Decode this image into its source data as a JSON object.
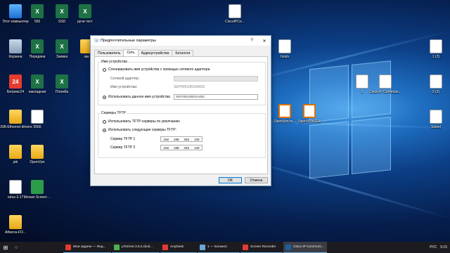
{
  "desktop": {
    "icons": [
      {
        "label": "Этот компьютер",
        "glyph": "",
        "cls": "g-pc",
        "icon": "computer-icon"
      },
      {
        "label": "555",
        "glyph": "X",
        "cls": "g-xls",
        "icon": "excel-icon"
      },
      {
        "label": "SSD",
        "glyph": "X",
        "cls": "g-xls",
        "icon": "excel-icon"
      },
      {
        "label": "ручи тест",
        "glyph": "X",
        "cls": "g-xls",
        "icon": "excel-icon"
      },
      {
        "label": "CiscoIPCo...",
        "glyph": "C",
        "cls": "g-cisco",
        "icon": "cisco-icon"
      },
      {
        "label": "Корзина",
        "glyph": "",
        "cls": "g-bin",
        "icon": "recycle-bin-icon"
      },
      {
        "label": "Передача",
        "glyph": "X",
        "cls": "g-xls",
        "icon": "excel-icon"
      },
      {
        "label": "Заявка",
        "glyph": "X",
        "cls": "g-xls",
        "icon": "excel-icon"
      },
      {
        "label": "зак",
        "glyph": "",
        "cls": "g-folder",
        "icon": "folder-icon"
      },
      {
        "label": "hosts",
        "glyph": "",
        "cls": "g-doc",
        "icon": "document-icon"
      },
      {
        "label": "1 (2)",
        "glyph": "",
        "cls": "g-doc",
        "icon": "document-icon"
      },
      {
        "label": "Битрикс24",
        "glyph": "24",
        "cls": "g-app",
        "icon": "bitrix24-icon"
      },
      {
        "label": "накладная",
        "glyph": "X",
        "cls": "g-xls",
        "icon": "excel-icon"
      },
      {
        "label": "Пломба",
        "glyph": "X",
        "cls": "g-xls",
        "icon": "excel-icon"
      },
      {
        "label": "1",
        "glyph": "",
        "cls": "g-doc",
        "icon": "document-icon"
      },
      {
        "label": "Cisco IP Communi...",
        "glyph": "C",
        "cls": "g-cisco",
        "icon": "cisco-icon"
      },
      {
        "label": "2 (2)",
        "glyph": "",
        "cls": "g-doc",
        "icon": "document-icon"
      },
      {
        "label": "USB-Ethernet drivers",
        "glyph": "",
        "cls": "g-usb",
        "icon": "folder-icon"
      },
      {
        "label": "5566",
        "glyph": "",
        "cls": "g-doc",
        "icon": "document-icon"
      },
      {
        "label": "OpenVpn-in...",
        "glyph": "V",
        "cls": "g-vpn",
        "icon": "openvpn-icon"
      },
      {
        "label": "OpenVPN GUI",
        "glyph": "V",
        "cls": "g-vpn",
        "icon": "openvpn-icon"
      },
      {
        "label": "Siebel",
        "glyph": "",
        "cls": "g-doc",
        "icon": "document-icon"
      },
      {
        "label": "job",
        "glyph": "",
        "cls": "g-folder",
        "icon": "folder-icon"
      },
      {
        "label": "OpenVpn",
        "glyph": "",
        "cls": "g-folder",
        "icon": "folder-icon"
      },
      {
        "label": "rufus-3.17",
        "glyph": "",
        "cls": "g-doc",
        "icon": "rufus-icon"
      },
      {
        "label": "Movavi Screen ...",
        "glyph": "",
        "cls": "g-green",
        "icon": "movavi-icon"
      },
      {
        "label": "Atheros-FO...",
        "glyph": "",
        "cls": "g-folder",
        "icon": "folder-icon"
      }
    ]
  },
  "dialog": {
    "title": "Предпочтительные параметры",
    "help": "?",
    "close": "✕",
    "tabs": [
      "Пользователь",
      "Сеть",
      "Аудиоустройства",
      "Каталоги"
    ],
    "device_group": {
      "legend": "Имя устройства",
      "radio_adapter": "Сгенерировать имя устройства с помощью сетевого адаптера",
      "adapter_label": "Сетевой адаптер:",
      "adapter_value": "",
      "devname_label": "Имя устройства:",
      "devname_value": "SEP4061860SA692",
      "radio_custom": "Использовать данное имя устройства",
      "custom_value": "SEP4061860SA692"
    },
    "tftp_group": {
      "legend": "Серверы TFTP",
      "radio_default": "Использовать TFTP-серверы по умолчанию",
      "radio_custom": "Использовать следующие серверы TFTP:",
      "server1_label": "Сервер TFTP 1",
      "server1": [
        "192",
        "168",
        "253",
        "130"
      ],
      "server2_label": "Сервер TFTP 2",
      "server2": [
        "192",
        "168",
        "253",
        "140"
      ]
    },
    "ok": "OK",
    "cancel": "Отмена"
  },
  "taskbar": {
    "items": [
      {
        "label": "Мои задачи — Янд...",
        "color": "#e63b2e",
        "icon": "yandex-browser-icon",
        "active": false
      },
      {
        "label": "μTorrent 3.5.5 (buil...",
        "color": "#4caf50",
        "icon": "utorrent-icon",
        "active": false
      },
      {
        "label": "AnyDesk",
        "color": "#e53935",
        "icon": "anydesk-icon",
        "active": false
      },
      {
        "label": "1 — Блокнот",
        "color": "#6aa7d8",
        "icon": "notepad-icon",
        "active": false
      },
      {
        "label": "Screen Recorder",
        "color": "#e53935",
        "icon": "screen-recorder-icon",
        "active": false
      },
      {
        "label": "Cisco IP Communi...",
        "color": "#1a5fa0",
        "icon": "cisco-icon",
        "active": true
      }
    ],
    "lang": "РУС",
    "time": "9:15"
  }
}
